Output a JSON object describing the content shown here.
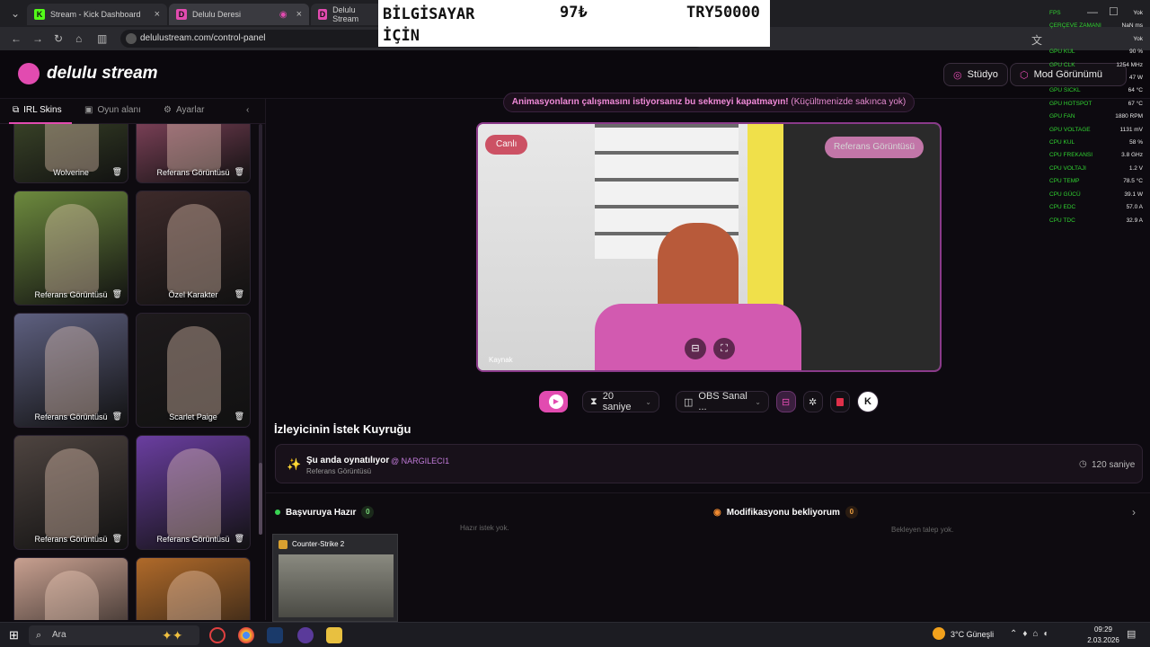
{
  "browser": {
    "tabs": [
      {
        "label": "Stream - Kick Dashboard",
        "close": "×",
        "fav": "K"
      },
      {
        "label": "Delulu Deresi",
        "close": "×",
        "fav": "D"
      },
      {
        "label": "Delulu Stream",
        "fav": "D"
      }
    ],
    "url": "delulustream.com/control-panel"
  },
  "overlay": {
    "item": "BİLGİSAYAR İÇİN",
    "price": "97₺",
    "goal": "TRY50000"
  },
  "header": {
    "brand": "delulu stream",
    "studio_label": "Stüdyo",
    "mod_label": "Mod Görünümü"
  },
  "sidebar": {
    "tabs": [
      {
        "label": "IRL Skins"
      },
      {
        "label": "Oyun alanı"
      },
      {
        "label": "Ayarlar"
      }
    ],
    "skins": [
      {
        "name": "Wolverine",
        "bg": "#4c5a32"
      },
      {
        "name": "Referans Görüntüsü",
        "bg": "#b0587a"
      },
      {
        "name": "Referans Görüntüsü",
        "bg": "#6d8a3e"
      },
      {
        "name": "Özel Karakter",
        "bg": "#3d2a2a"
      },
      {
        "name": "Referans Görüntüsü",
        "bg": "#5e6080"
      },
      {
        "name": "Scarlet Paige",
        "bg": "#1e1a1c"
      },
      {
        "name": "Referans Görüntüsü",
        "bg": "#4e4440"
      },
      {
        "name": "Referans Görüntüsü",
        "bg": "#6a3ea0"
      },
      {
        "name": "",
        "bg": "#c8a090"
      },
      {
        "name": "",
        "bg": "#b06a2a"
      }
    ]
  },
  "main": {
    "warning_bold": "Animasyonların çalışmasını istiyorsanız bu sekmeyi kapatmayın!",
    "warning_rest": " (Küçültmenizde sakınca yok)",
    "preview": {
      "live_label": "Canlı",
      "ref_label": "Referans Görüntüsü",
      "source_label": "Kaynak"
    },
    "controls": {
      "duration": "20 saniye",
      "camera": "OBS Sanal ...",
      "brand_letter": "K"
    },
    "queue": {
      "title": "İzleyicinin İstek Kuyruğu",
      "now_playing": "Şu anda oynatılıyor",
      "requester": "@ NARGILECI1",
      "subtitle": "Referans Görüntüsü",
      "seconds": "120 saniye"
    },
    "ready": {
      "label": "Başvuruya Hazır",
      "count": "0",
      "empty": "Hazır istek yok."
    },
    "waiting": {
      "label": "Modifikasyonu bekliyorum",
      "count": "0",
      "empty": "Bekleyen talep yok."
    },
    "popup_title": "Counter-Strike 2"
  },
  "hwmon": [
    {
      "k": "FPS",
      "v": "Yok"
    },
    {
      "k": "ÇERÇEVE ZAMANI",
      "v": "NaN ms"
    },
    {
      "k": "",
      "v": "Yok"
    },
    {
      "k": "GPU KUL",
      "v": "90 %"
    },
    {
      "k": "GPU CLK",
      "v": "1254 MHz"
    },
    {
      "k": "",
      "v": "47 W"
    },
    {
      "k": "GPU SICKL",
      "v": "64 °C"
    },
    {
      "k": "GPU HOTSPOT",
      "v": "67 °C"
    },
    {
      "k": "GPU FAN",
      "v": "1880 RPM"
    },
    {
      "k": "GPU VOLTAGE",
      "v": "1131 mV"
    },
    {
      "k": "CPU KUL",
      "v": "58 %"
    },
    {
      "k": "CPU FREKANSI",
      "v": "3.8 GHz"
    },
    {
      "k": "CPU VOLTAJI",
      "v": "1.2 V"
    },
    {
      "k": "CPU TEMP",
      "v": "78.5 °C"
    },
    {
      "k": "CPU GÜCÜ",
      "v": "39.1 W"
    },
    {
      "k": "CPU EDC",
      "v": "57.0 A"
    },
    {
      "k": "CPU TDC",
      "v": "32.9 A"
    }
  ],
  "taskbar": {
    "search": "Ara",
    "weather": "3°C  Güneşli",
    "time": "09:29",
    "date": "2.03.2026"
  },
  "colors": {
    "accent": "#e24bb0",
    "hw_green": "#31d331"
  }
}
